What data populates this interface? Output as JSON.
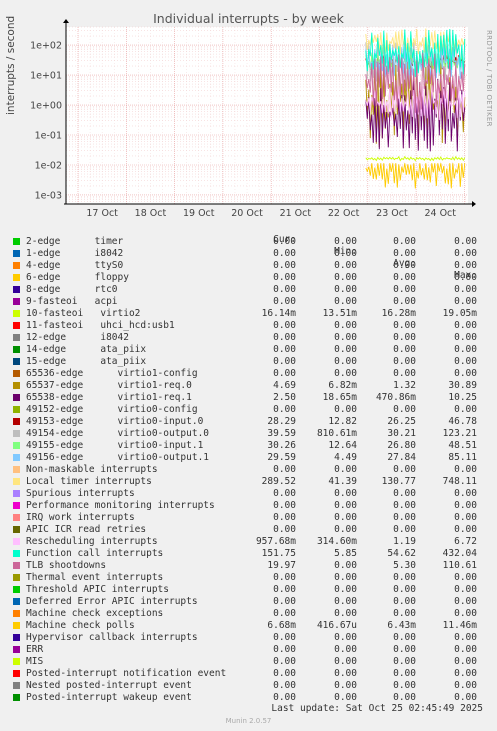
{
  "chart_data": {
    "type": "line",
    "title": "Individual interrupts - by week",
    "ylabel": "interrupts / second",
    "yscale": "log",
    "ylim": [
      0.0005,
      400
    ],
    "y_ticks": [
      "1e+02",
      "1e+01",
      "1e+00",
      "1e-01",
      "1e-02",
      "1e-03"
    ],
    "x_ticks": [
      "17 Oct",
      "18 Oct",
      "19 Oct",
      "20 Oct",
      "21 Oct",
      "22 Oct",
      "23 Oct",
      "24 Oct"
    ],
    "data_start": "23 Oct",
    "grid": true,
    "watermark": "RRDTOOL / TOBI OETIKER",
    "columns": [
      "Cur:",
      "Min:",
      "Avg:",
      "Max:"
    ],
    "series": [
      {
        "name": "2-edge      timer",
        "color": "#00cc00",
        "cur": "0.00",
        "min": "0.00",
        "avg": "0.00",
        "max": "0.00"
      },
      {
        "name": "1-edge      i8042",
        "color": "#0066b3",
        "cur": "0.00",
        "min": "0.00",
        "avg": "0.00",
        "max": "0.00"
      },
      {
        "name": "4-edge      ttyS0",
        "color": "#ff8000",
        "cur": "0.00",
        "min": "0.00",
        "avg": "0.00",
        "max": "0.00"
      },
      {
        "name": "6-edge      floppy",
        "color": "#ffcc00",
        "cur": "0.00",
        "min": "0.00",
        "avg": "0.00",
        "max": "0.00"
      },
      {
        "name": "8-edge      rtc0",
        "color": "#330099",
        "cur": "0.00",
        "min": "0.00",
        "avg": "0.00",
        "max": "0.00"
      },
      {
        "name": "9-fasteoi   acpi",
        "color": "#990099",
        "cur": "0.00",
        "min": "0.00",
        "avg": "0.00",
        "max": "0.00"
      },
      {
        "name": "10-fasteoi   virtio2",
        "color": "#ccff00",
        "cur": "16.14m",
        "min": "13.51m",
        "avg": "16.28m",
        "max": "19.05m"
      },
      {
        "name": "11-fasteoi   uhci_hcd:usb1",
        "color": "#ff0000",
        "cur": "0.00",
        "min": "0.00",
        "avg": "0.00",
        "max": "0.00"
      },
      {
        "name": "12-edge      i8042",
        "color": "#808080",
        "cur": "0.00",
        "min": "0.00",
        "avg": "0.00",
        "max": "0.00"
      },
      {
        "name": "14-edge      ata_piix",
        "color": "#008f00",
        "cur": "0.00",
        "min": "0.00",
        "avg": "0.00",
        "max": "0.00"
      },
      {
        "name": "15-edge      ata_piix",
        "color": "#00487d",
        "cur": "0.00",
        "min": "0.00",
        "avg": "0.00",
        "max": "0.00"
      },
      {
        "name": "65536-edge      virtio1-config",
        "color": "#b35a00",
        "cur": "0.00",
        "min": "0.00",
        "avg": "0.00",
        "max": "0.00"
      },
      {
        "name": "65537-edge      virtio1-req.0",
        "color": "#b38f00",
        "cur": "4.69",
        "min": "6.82m",
        "avg": "1.32",
        "max": "30.89"
      },
      {
        "name": "65538-edge      virtio1-req.1",
        "color": "#6b006b",
        "cur": "2.50",
        "min": "18.65m",
        "avg": "470.86m",
        "max": "10.25"
      },
      {
        "name": "49152-edge      virtio0-config",
        "color": "#8fb300",
        "cur": "0.00",
        "min": "0.00",
        "avg": "0.00",
        "max": "0.00"
      },
      {
        "name": "49153-edge      virtio0-input.0",
        "color": "#b30000",
        "cur": "28.29",
        "min": "12.82",
        "avg": "26.25",
        "max": "46.78"
      },
      {
        "name": "49154-edge      virtio0-output.0",
        "color": "#bebebe",
        "cur": "39.59",
        "min": "810.61m",
        "avg": "30.21",
        "max": "123.21"
      },
      {
        "name": "49155-edge      virtio0-input.1",
        "color": "#80ff80",
        "cur": "30.26",
        "min": "12.64",
        "avg": "26.80",
        "max": "48.51"
      },
      {
        "name": "49156-edge      virtio0-output.1",
        "color": "#80c9ff",
        "cur": "29.59",
        "min": "4.49",
        "avg": "27.84",
        "max": "85.11"
      },
      {
        "name": "Non-maskable interrupts",
        "color": "#ffc080",
        "cur": "0.00",
        "min": "0.00",
        "avg": "0.00",
        "max": "0.00"
      },
      {
        "name": "Local timer interrupts",
        "color": "#ffe680",
        "cur": "289.52",
        "min": "41.39",
        "avg": "130.77",
        "max": "748.11"
      },
      {
        "name": "Spurious interrupts",
        "color": "#aa80ff",
        "cur": "0.00",
        "min": "0.00",
        "avg": "0.00",
        "max": "0.00"
      },
      {
        "name": "Performance monitoring interrupts",
        "color": "#ee00cc",
        "cur": "0.00",
        "min": "0.00",
        "avg": "0.00",
        "max": "0.00"
      },
      {
        "name": "IRQ work interrupts",
        "color": "#ff8080",
        "cur": "0.00",
        "min": "0.00",
        "avg": "0.00",
        "max": "0.00"
      },
      {
        "name": "APIC ICR read retries",
        "color": "#666600",
        "cur": "0.00",
        "min": "0.00",
        "avg": "0.00",
        "max": "0.00"
      },
      {
        "name": "Rescheduling interrupts",
        "color": "#ffbfff",
        "cur": "957.68m",
        "min": "314.60m",
        "avg": "1.19",
        "max": "6.72"
      },
      {
        "name": "Function call interrupts",
        "color": "#00ffcc",
        "cur": "151.75",
        "min": "5.85",
        "avg": "54.62",
        "max": "432.04"
      },
      {
        "name": "TLB shootdowns",
        "color": "#cc6699",
        "cur": "19.97",
        "min": "0.00",
        "avg": "5.30",
        "max": "110.61"
      },
      {
        "name": "Thermal event interrupts",
        "color": "#999900",
        "cur": "0.00",
        "min": "0.00",
        "avg": "0.00",
        "max": "0.00"
      },
      {
        "name": "Threshold APIC interrupts",
        "color": "#00cc00",
        "cur": "0.00",
        "min": "0.00",
        "avg": "0.00",
        "max": "0.00"
      },
      {
        "name": "Deferred Error APIC interrupts",
        "color": "#0066b3",
        "cur": "0.00",
        "min": "0.00",
        "avg": "0.00",
        "max": "0.00"
      },
      {
        "name": "Machine check exceptions",
        "color": "#ff8000",
        "cur": "0.00",
        "min": "0.00",
        "avg": "0.00",
        "max": "0.00"
      },
      {
        "name": "Machine check polls",
        "color": "#ffcc00",
        "cur": "6.68m",
        "min": "416.67u",
        "avg": "6.43m",
        "max": "11.46m"
      },
      {
        "name": "Hypervisor callback interrupts",
        "color": "#330099",
        "cur": "0.00",
        "min": "0.00",
        "avg": "0.00",
        "max": "0.00"
      },
      {
        "name": "ERR",
        "color": "#990099",
        "cur": "0.00",
        "min": "0.00",
        "avg": "0.00",
        "max": "0.00"
      },
      {
        "name": "MIS",
        "color": "#ccff00",
        "cur": "0.00",
        "min": "0.00",
        "avg": "0.00",
        "max": "0.00"
      },
      {
        "name": "Posted-interrupt notification event",
        "color": "#ff0000",
        "cur": "0.00",
        "min": "0.00",
        "avg": "0.00",
        "max": "0.00"
      },
      {
        "name": "Nested posted-interrupt event",
        "color": "#808080",
        "cur": "0.00",
        "min": "0.00",
        "avg": "0.00",
        "max": "0.00"
      },
      {
        "name": "Posted-interrupt wakeup event",
        "color": "#008f00",
        "cur": "0.00",
        "min": "0.00",
        "avg": "0.00",
        "max": "0.00"
      }
    ]
  },
  "last_update": "Last update: Sat Oct 25 02:45:49 2025",
  "footer": "Munin 2.0.57"
}
